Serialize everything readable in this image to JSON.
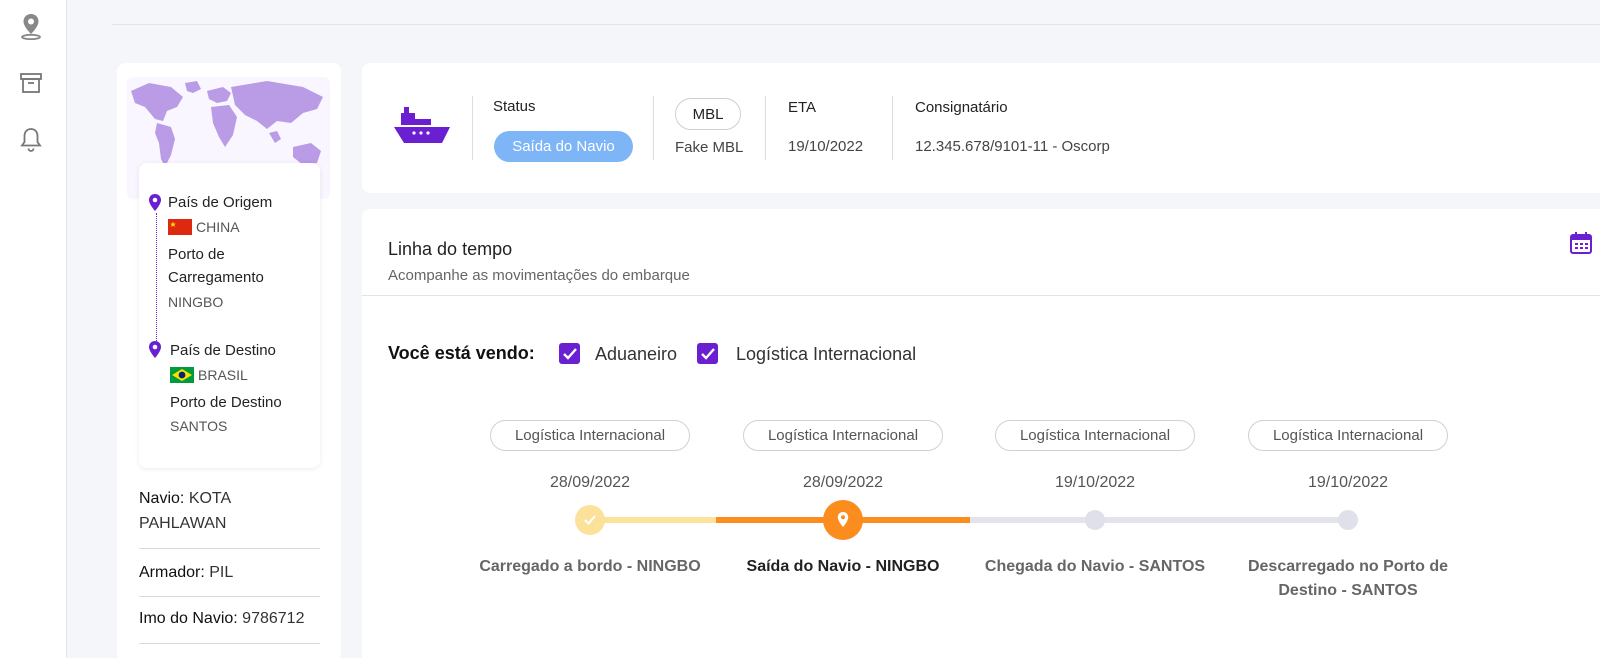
{
  "rail": {
    "icons": [
      "location-pin-icon",
      "archive-icon",
      "bell-icon"
    ]
  },
  "route": {
    "origin_country_label": "País de Origem",
    "origin_country": "CHINA",
    "load_port_label": "Porto de Carregamento",
    "load_port": "NINGBO",
    "dest_country_label": "País de Destino",
    "dest_country": "BRASIL",
    "dest_port_label": "Porto de Destino",
    "dest_port": "SANTOS"
  },
  "vessel": {
    "ship_label": "Navio:",
    "ship_value": "KOTA PAHLAWAN",
    "owner_label": "Armador:",
    "owner_value": "PIL",
    "imo_label": "Imo do Navio:",
    "imo_value": "9786712"
  },
  "header": {
    "status_label": "Status",
    "status_value": "Saída do Navio",
    "mbl_label": "MBL",
    "mbl_value": "Fake MBL",
    "eta_label": "ETA",
    "eta_value": "19/10/2022",
    "consignee_label": "Consignatário",
    "consignee_value": "12.345.678/9101-11 - Oscorp"
  },
  "timeline": {
    "title": "Linha do tempo",
    "subtitle": "Acompanhe as movimentações do embarque",
    "viewing_label": "Você está vendo:",
    "filters": [
      {
        "label": "Aduaneiro",
        "checked": true
      },
      {
        "label": "Logística Internacional",
        "checked": true
      }
    ],
    "steps": [
      {
        "category": "Logística Internacional",
        "date": "28/09/2022",
        "name": "Carregado a bordo - NINGBO",
        "state": "done"
      },
      {
        "category": "Logística Internacional",
        "date": "28/09/2022",
        "name": "Saída do Navio - NINGBO",
        "state": "current"
      },
      {
        "category": "Logística Internacional",
        "date": "19/10/2022",
        "name": "Chegada do Navio - SANTOS",
        "state": "pending"
      },
      {
        "category": "Logística Internacional",
        "date": "19/10/2022",
        "name": "Descarregado no Porto de Destino - SANTOS",
        "state": "pending"
      }
    ]
  },
  "colors": {
    "accent": "#6a1fd0",
    "status_pill": "#7db5f7",
    "current": "#fb8c1e",
    "done": "#fce19a",
    "pending": "#e0e0ea"
  }
}
